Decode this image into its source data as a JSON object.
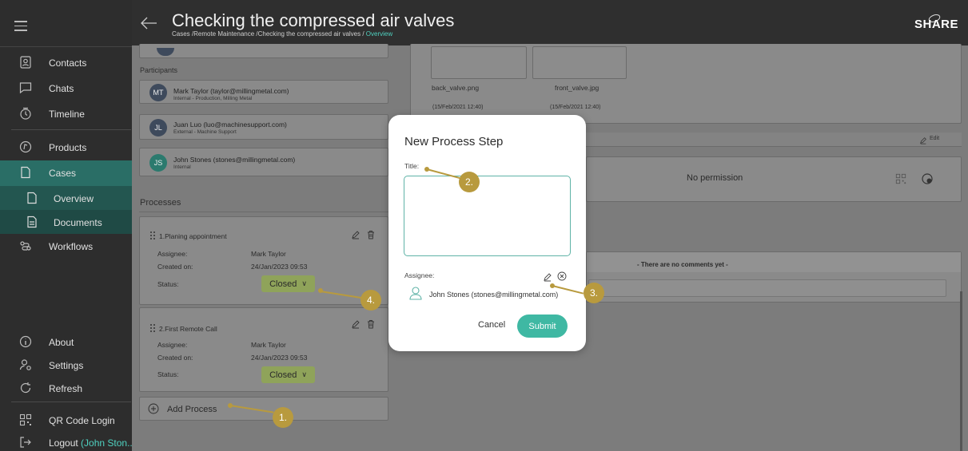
{
  "topbar": {
    "title": "Checking the compressed air valves",
    "breadcrumb": "Cases /Remote Maintenance /Checking the compressed air valves / ",
    "breadcrumb_current": "Overview",
    "logo": "SHARE"
  },
  "sidebar": {
    "items": [
      {
        "label": "Contacts"
      },
      {
        "label": "Chats"
      },
      {
        "label": "Timeline"
      },
      {
        "label": "Products"
      },
      {
        "label": "Cases"
      },
      {
        "label": "Overview"
      },
      {
        "label": "Documents"
      },
      {
        "label": "Workflows"
      },
      {
        "label": "About"
      },
      {
        "label": "Settings"
      },
      {
        "label": "Refresh"
      },
      {
        "label": "QR Code Login"
      },
      {
        "label": "Logout",
        "suffix": "(John Ston..."
      }
    ]
  },
  "participants": {
    "label": "Participants",
    "list": [
      {
        "initials": "MT",
        "name": "Mark Taylor (taylor@millingmetal.com)",
        "sub": "Internal - Production, Milling Metal"
      },
      {
        "initials": "JL",
        "name": "Juan Luo (luo@machinesupport.com)",
        "sub": "External - Machine Support"
      },
      {
        "initials": "JS",
        "name": "John Stones (stones@millingmetal.com)",
        "sub": "Internal"
      }
    ]
  },
  "processes": {
    "label": "Processes",
    "items": [
      {
        "title": "1.Planing appointment",
        "assignee_label": "Assignee:",
        "assignee": "Mark Taylor",
        "created_label": "Created on:",
        "created": "24/Jan/2023 09:53",
        "status_label": "Status:",
        "status": "Closed"
      },
      {
        "title": "2.First Remote Call",
        "assignee_label": "Assignee:",
        "assignee": "Mark Taylor",
        "created_label": "Created on:",
        "created": "24/Jan/2023 09:53",
        "status_label": "Status:",
        "status": "Closed"
      }
    ],
    "add_label": "Add Process"
  },
  "files": [
    {
      "name": "back_valve.png",
      "date": "(15/Feb/2021 12:40)"
    },
    {
      "name": "front_valve.jpg",
      "date": "(15/Feb/2021 12:40)"
    }
  ],
  "right_panel": {
    "edit_label": "Edit",
    "no_permission": "No permission",
    "no_comments": "- There are no comments yet -"
  },
  "modal": {
    "title": "New Process Step",
    "title_label": "Title:",
    "title_value": "",
    "assignee_label": "Assignee:",
    "assignee_name": "John Stones (stones@millingmetal.com)",
    "cancel_label": "Cancel",
    "submit_label": "Submit"
  },
  "callouts": [
    "1.",
    "2.",
    "3.",
    "4."
  ],
  "colors": {
    "accent": "#3fb8a3",
    "callout": "#b89a3e",
    "status": "#8fa35a",
    "sidebar": "#2d2d2d"
  }
}
